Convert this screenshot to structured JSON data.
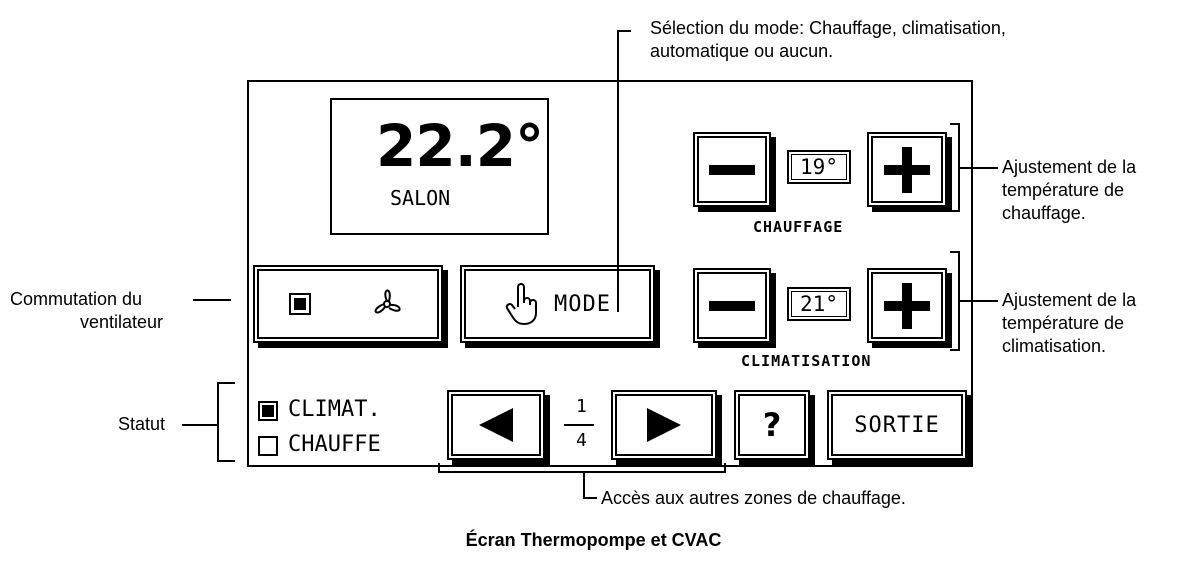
{
  "caption": "Écran Thermopompe et CVAC",
  "annotations": {
    "mode_select_line1": "Sélection du mode: Chauffage, climatisation,",
    "mode_select_line2": "automatique ou aucun.",
    "heat_adjust_line1": "Ajustement de la",
    "heat_adjust_line2": "température de",
    "heat_adjust_line3": "chauffage.",
    "cool_adjust_line1": "Ajustement de la",
    "cool_adjust_line2": "température de",
    "cool_adjust_line3": "climatisation.",
    "fan_switch_line1": "Commutation du",
    "fan_switch_line2": "ventilateur",
    "status": "Statut",
    "zones": "Accès aux autres zones de chauffage."
  },
  "display": {
    "temperature": "22.2°",
    "room": "SALON"
  },
  "heating": {
    "setpoint": "19°",
    "label": "CHAUFFAGE",
    "minus_icon": "minus-icon",
    "plus_icon": "plus-icon"
  },
  "cooling": {
    "setpoint": "21°",
    "label": "CLIMATISATION",
    "minus_icon": "minus-icon",
    "plus_icon": "plus-icon"
  },
  "fan_button": {
    "icons": [
      "filled-square-icon",
      "fan-icon"
    ]
  },
  "mode_button": {
    "icon": "hand-pointer-icon",
    "label": "MODE"
  },
  "status": {
    "items": [
      {
        "label": "CLIMAT.",
        "checked": true
      },
      {
        "label": "CHAUFFE",
        "checked": false
      }
    ]
  },
  "zone_nav": {
    "current": "1",
    "total": "4",
    "prev_icon": "left-arrow-icon",
    "next_icon": "right-arrow-icon"
  },
  "help_button": {
    "label": "?"
  },
  "exit_button": {
    "label": "SORTIE"
  }
}
